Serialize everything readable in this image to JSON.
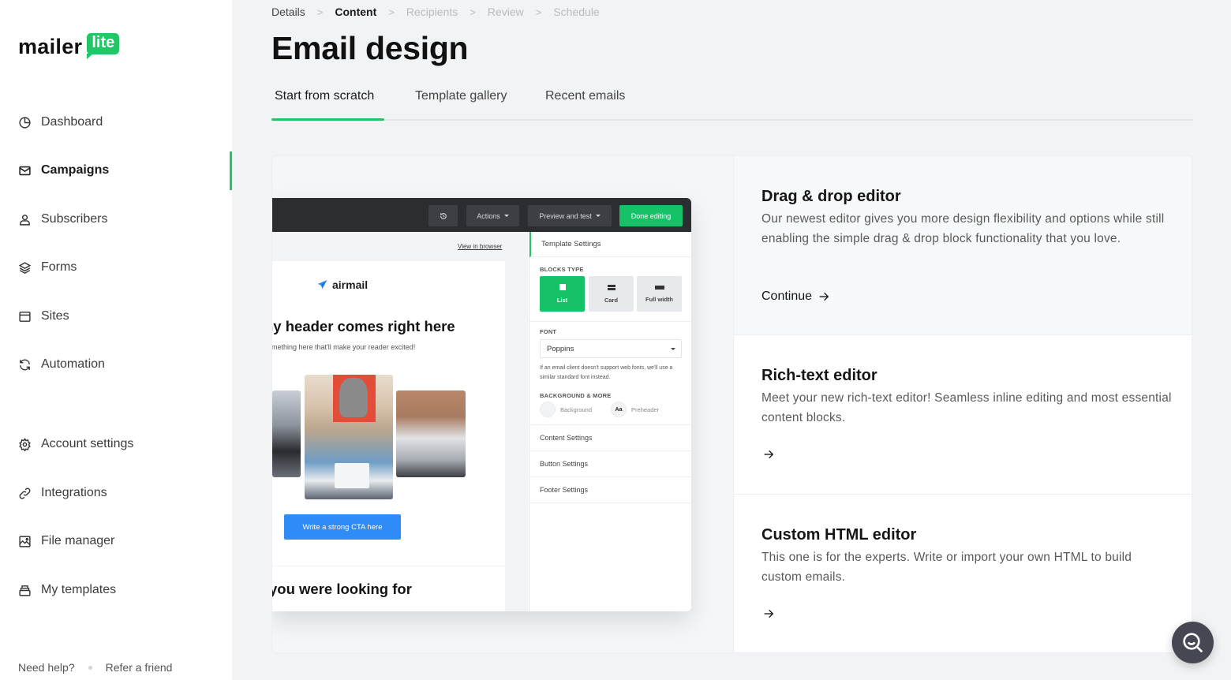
{
  "brand": {
    "name": "mailer",
    "badge": "lite",
    "accent": "#24c567"
  },
  "sidebar": {
    "items": [
      {
        "label": "Dashboard",
        "icon": "dashboard-icon",
        "active": false
      },
      {
        "label": "Campaigns",
        "icon": "mail-icon",
        "active": true
      },
      {
        "label": "Subscribers",
        "icon": "user-icon",
        "active": false
      },
      {
        "label": "Forms",
        "icon": "layers-icon",
        "active": false
      },
      {
        "label": "Sites",
        "icon": "browser-icon",
        "active": false
      },
      {
        "label": "Automation",
        "icon": "refresh-icon",
        "active": false
      },
      {
        "label": "Account settings",
        "icon": "gear-icon",
        "active": false
      },
      {
        "label": "Integrations",
        "icon": "link-icon",
        "active": false
      },
      {
        "label": "File manager",
        "icon": "image-icon",
        "active": false
      },
      {
        "label": "My templates",
        "icon": "templates-icon",
        "active": false
      }
    ],
    "footer": {
      "help": "Need help?",
      "refer": "Refer a friend"
    }
  },
  "breadcrumb": [
    {
      "label": "Details",
      "state": "done"
    },
    {
      "label": "Content",
      "state": "current"
    },
    {
      "label": "Recipients",
      "state": "upcoming"
    },
    {
      "label": "Review",
      "state": "upcoming"
    },
    {
      "label": "Schedule",
      "state": "upcoming"
    }
  ],
  "page": {
    "title": "Email design"
  },
  "tabs": [
    {
      "label": "Start from scratch",
      "active": true
    },
    {
      "label": "Template gallery",
      "active": false
    },
    {
      "label": "Recent emails",
      "active": false
    }
  ],
  "preview": {
    "toolbar": {
      "actions": "Actions",
      "preview": "Preview and test",
      "done": "Done editing"
    },
    "view_in_browser": "View in browser",
    "email": {
      "logo": "airmail",
      "headline": "ny header comes right here",
      "subline": "omething here that'll make your reader excited!",
      "cta": "Write a strong CTA here",
      "headline2": "you were looking for"
    },
    "settings": {
      "header": "Template Settings",
      "blocks_type_label": "BLOCKS TYPE",
      "blocks": [
        {
          "label": "List",
          "active": true
        },
        {
          "label": "Card",
          "active": false
        },
        {
          "label": "Full width",
          "active": false
        }
      ],
      "font_label": "FONT",
      "font_value": "Poppins",
      "font_note": "If an email client doesn't support web fonts, we'll use a similar standard font instead.",
      "bg_label": "BACKGROUND & MORE",
      "background": "Background",
      "preheader_glyph": "Aa",
      "preheader": "Preheader",
      "rows": [
        "Content Settings",
        "Button Settings",
        "Footer Settings"
      ]
    }
  },
  "options": [
    {
      "title": "Drag & drop editor",
      "description": "Our newest editor gives you more design flexibility and options while still enabling the simple drag & drop block functionality that you love.",
      "link": "Continue"
    },
    {
      "title": "Rich-text editor",
      "description": "Meet your new rich-text editor! Seamless inline editing and most essential content blocks.",
      "link": ""
    },
    {
      "title": "Custom HTML editor",
      "description": "This one is for the experts. Write or import your own HTML to build custom emails.",
      "link": ""
    }
  ]
}
